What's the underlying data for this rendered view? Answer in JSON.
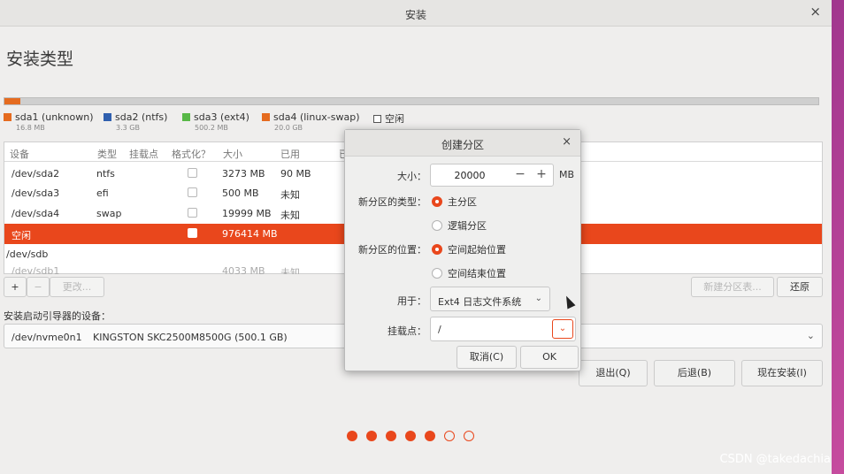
{
  "window": {
    "title": "安装",
    "close_glyph": "×"
  },
  "page_heading": "安装类型",
  "legend": [
    {
      "label": "sda1 (unknown)",
      "size": "16.8 MB",
      "color": "#e56b1f"
    },
    {
      "label": "sda2 (ntfs)",
      "size": "3.3 GB",
      "color": "#2f5fae"
    },
    {
      "label": "sda3 (ext4)",
      "size": "500.2 MB",
      "color": "#58b847"
    },
    {
      "label": "sda4 (linux-swap)",
      "size": "20.0 GB",
      "color": "#e56b1f"
    },
    {
      "label": "空闲",
      "size": ""
    }
  ],
  "table": {
    "headers": [
      "设备",
      "类型",
      "挂载点",
      "格式化？",
      "大小",
      "已用",
      "已"
    ],
    "rows": [
      {
        "device": "/dev/sda2",
        "type": "ntfs",
        "mount": "",
        "size": "3273 MB",
        "used": "90 MB"
      },
      {
        "device": "/dev/sda3",
        "type": "efi",
        "mount": "",
        "size": "500 MB",
        "used": "未知"
      },
      {
        "device": "/dev/sda4",
        "type": "swap",
        "mount": "",
        "size": "19999 MB",
        "used": "未知"
      },
      {
        "device": "空闲",
        "type": "",
        "mount": "",
        "size": "976414 MB",
        "used": ""
      },
      {
        "device": "/dev/sdb",
        "type": "",
        "mount": "",
        "size": "",
        "used": ""
      },
      {
        "device": "/dev/sdb1",
        "type": "",
        "mount": "",
        "size": "4033 MB",
        "used": "未知"
      }
    ]
  },
  "table_tools": {
    "add": "+",
    "remove": "−",
    "change": "更改...",
    "new_table": "新建分区表...",
    "revert": "还原"
  },
  "boot_loader": {
    "label": "安装启动引导器的设备：",
    "device": "/dev/nvme0n1",
    "description": "KINGSTON SKC2500M8500G (500.1 GB)"
  },
  "nav": {
    "quit": "退出(Q)",
    "back": "后退(B)",
    "install_now": "现在安装(I)"
  },
  "progress_dots": {
    "total": 7,
    "filled": 5
  },
  "dialog": {
    "title": "创建分区",
    "size_label": "大小：",
    "size_value": "20000",
    "size_unit": "MB",
    "minus": "−",
    "plus": "+",
    "type_label": "新分区的类型：",
    "type_primary": "主分区",
    "type_logical": "逻辑分区",
    "location_label": "新分区的位置：",
    "location_begin": "空间起始位置",
    "location_end": "空间结束位置",
    "use_label": "用于：",
    "use_value": "Ext4 日志文件系统",
    "mount_label": "挂载点：",
    "mount_value": "/",
    "cancel": "取消(C)",
    "ok": "OK"
  },
  "watermark": "CSDN @takedachia",
  "colors": {
    "accent": "#e9471c",
    "background": "#efeeed",
    "desktop": "#a83590"
  }
}
